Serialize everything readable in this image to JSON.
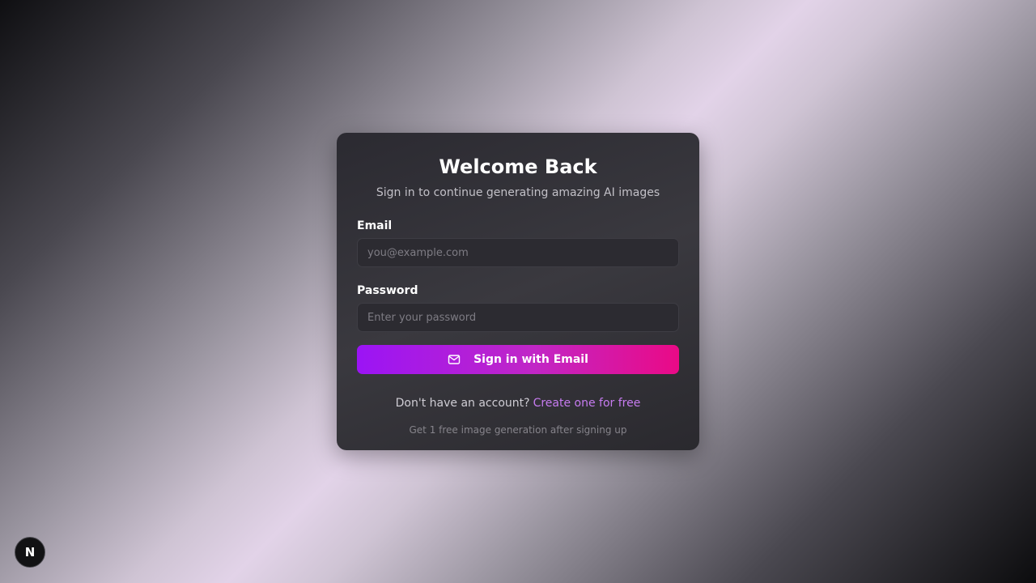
{
  "login": {
    "title": "Welcome Back",
    "subtitle": "Sign in to continue generating amazing AI images",
    "email_label": "Email",
    "email_placeholder": "you@example.com",
    "email_value": "",
    "password_label": "Password",
    "password_placeholder": "Enter your password",
    "password_value": "",
    "submit_label": "Sign in with Email",
    "submit_icon": "mail-icon",
    "signup_prompt": "Don't have an account?",
    "signup_link": "Create one for free",
    "free_note": "Get 1 free image generation after signing up"
  },
  "dev_badge": {
    "label": "N"
  },
  "colors": {
    "accent_start": "#9b14f5",
    "accent_end": "#ea0a86",
    "link": "#c67bf0",
    "card_bg": "#2b2a31"
  }
}
